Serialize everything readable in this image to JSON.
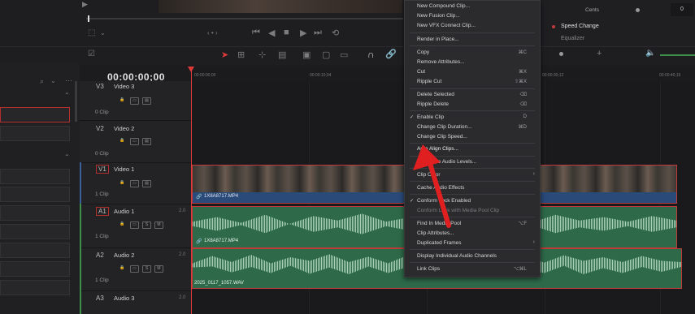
{
  "inspector": {
    "cents_label": "Cents",
    "cents_value": "0",
    "speed_change": "Speed Change",
    "equalizer": "Equalizer"
  },
  "timeline": {
    "timecode": "00:00:00;00",
    "ruler_ticks": [
      "00:00:00;00",
      "00:00:10;04",
      "00:00:30;12",
      "00:00:40;16"
    ]
  },
  "tracks": [
    {
      "id": "V3",
      "name": "Video 3",
      "clips": "0 Clip"
    },
    {
      "id": "V2",
      "name": "Video 2",
      "clips": "0 Clip"
    },
    {
      "id": "V1",
      "name": "Video 1",
      "clips": "1 Clip"
    },
    {
      "id": "A1",
      "name": "Audio 1",
      "clips": "1 Clip",
      "vol": "2.0"
    },
    {
      "id": "A2",
      "name": "Audio 2",
      "clips": "1 Clip",
      "vol": "2.0"
    },
    {
      "id": "A3",
      "name": "Audio 3",
      "clips": "",
      "vol": "2.0"
    }
  ],
  "clips": {
    "video": "1X8A8717.MP4",
    "audio1": "1X8A8717.MP4",
    "audio2": "2025_0117_1057.WAV"
  },
  "menu": {
    "items": [
      {
        "label": "New Compound Clip...",
        "shortcut": ""
      },
      {
        "label": "New Fusion Clip...",
        "shortcut": ""
      },
      {
        "label": "New VFX Connect Clip...",
        "shortcut": ""
      },
      {
        "label": "Render in Place...",
        "shortcut": ""
      },
      {
        "label": "Copy",
        "shortcut": "⌘C"
      },
      {
        "label": "Remove Attributes...",
        "shortcut": ""
      },
      {
        "label": "Cut",
        "shortcut": "⌘X"
      },
      {
        "label": "Ripple Cut",
        "shortcut": "⇧⌘X"
      },
      {
        "label": "Delete Selected",
        "shortcut": "⌫"
      },
      {
        "label": "Ripple Delete",
        "shortcut": "⌫"
      },
      {
        "label": "Enable Clip",
        "shortcut": "D"
      },
      {
        "label": "Change Clip Duration...",
        "shortcut": "⌘D"
      },
      {
        "label": "Change Clip Speed...",
        "shortcut": ""
      },
      {
        "label": "Auto Align Clips...",
        "shortcut": ""
      },
      {
        "label": "Normalize Audio Levels...",
        "shortcut": ""
      },
      {
        "label": "Clip Color",
        "shortcut": ""
      },
      {
        "label": "Cache Audio Effects",
        "shortcut": ""
      },
      {
        "label": "Conform Lock Enabled",
        "shortcut": ""
      },
      {
        "label": "Conform Lock with Media Pool Clip",
        "shortcut": ""
      },
      {
        "label": "Find In Media Pool",
        "shortcut": "⌥F"
      },
      {
        "label": "Clip Attributes...",
        "shortcut": ""
      },
      {
        "label": "Duplicated Frames",
        "shortcut": ""
      },
      {
        "label": "Display Individual Audio Channels",
        "shortcut": ""
      },
      {
        "label": "Link Clips",
        "shortcut": "⌥⌘L"
      }
    ]
  },
  "colors": {
    "accent_red": "#e03a3a",
    "video_clip": "#2a4a7a",
    "audio_clip": "#2e6a4a"
  }
}
